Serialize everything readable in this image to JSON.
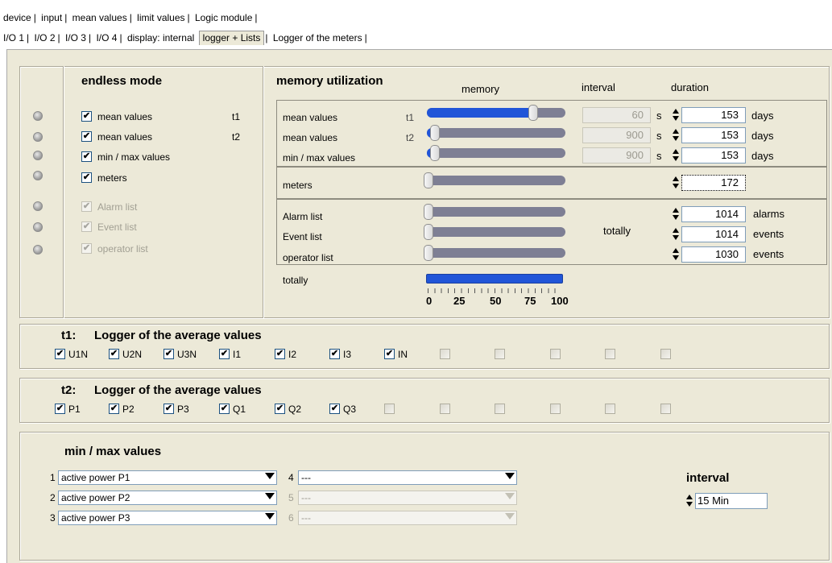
{
  "tabs_row1": [
    "device",
    "input",
    "mean values",
    "limit values",
    "Logic module"
  ],
  "tabs_row2": [
    "I/O 1",
    "I/O 2",
    "I/O 3",
    "I/O 4",
    "display: internal",
    "logger + Lists",
    "Logger of the meters"
  ],
  "endless": {
    "title": "endless mode",
    "items": [
      {
        "label": "mean values",
        "suffix": "t1",
        "checked": true
      },
      {
        "label": "mean values",
        "suffix": "t2",
        "checked": true
      },
      {
        "label": "min / max values",
        "suffix": "",
        "checked": true
      },
      {
        "label": "meters",
        "suffix": "",
        "checked": true
      },
      {
        "label": "Alarm list",
        "suffix": "",
        "checked": true,
        "disabled": true
      },
      {
        "label": "Event list",
        "suffix": "",
        "checked": true,
        "disabled": true
      },
      {
        "label": "operator list",
        "suffix": "",
        "checked": true,
        "disabled": true
      }
    ]
  },
  "memory": {
    "title": "memory utilization",
    "col_memory": "memory",
    "col_interval": "interval",
    "col_duration": "duration",
    "rows": [
      {
        "label": "mean values",
        "tag": "t1",
        "level": 0.8,
        "interval": "60",
        "unit": "s",
        "duration": "153",
        "dunit": "days"
      },
      {
        "label": "mean values",
        "tag": "t2",
        "level": 0.05,
        "interval": "900",
        "unit": "s",
        "duration": "153",
        "dunit": "days"
      },
      {
        "label": "min / max values",
        "tag": "",
        "level": 0.05,
        "interval": "900",
        "unit": "s",
        "duration": "153",
        "dunit": "days"
      }
    ],
    "meters": {
      "label": "meters",
      "value": "172"
    },
    "lists": [
      {
        "label": "Alarm list",
        "value": "1014",
        "unit": "alarms"
      },
      {
        "label": "Event list",
        "value": "1014",
        "unit": "events"
      },
      {
        "label": "operator list",
        "value": "1030",
        "unit": "events"
      }
    ],
    "lists_totally": "totally",
    "total": {
      "label": "totally",
      "level": 1.0,
      "ticks": [
        "0",
        "25",
        "50",
        "75",
        "100"
      ]
    }
  },
  "t1": {
    "tag": "t1:",
    "title": "Logger of the average values",
    "items": [
      "U1N",
      "U2N",
      "U3N",
      "I1",
      "I2",
      "I3",
      "IN",
      "",
      "",
      "",
      "",
      ""
    ]
  },
  "t2": {
    "tag": "t2:",
    "title": "Logger of the average values",
    "items": [
      "P1",
      "P2",
      "P3",
      "Q1",
      "Q2",
      "Q3",
      "",
      "",
      "",
      "",
      "",
      ""
    ]
  },
  "minmax": {
    "title": "min / max values",
    "selects": [
      {
        "num": "1",
        "value": "active power P1"
      },
      {
        "num": "2",
        "value": "active power P2"
      },
      {
        "num": "3",
        "value": "active power P3"
      },
      {
        "num": "4",
        "value": "---"
      },
      {
        "num": "5",
        "value": "---"
      },
      {
        "num": "6",
        "value": "---"
      }
    ],
    "interval_label": "interval",
    "interval_value": "15 Min"
  }
}
